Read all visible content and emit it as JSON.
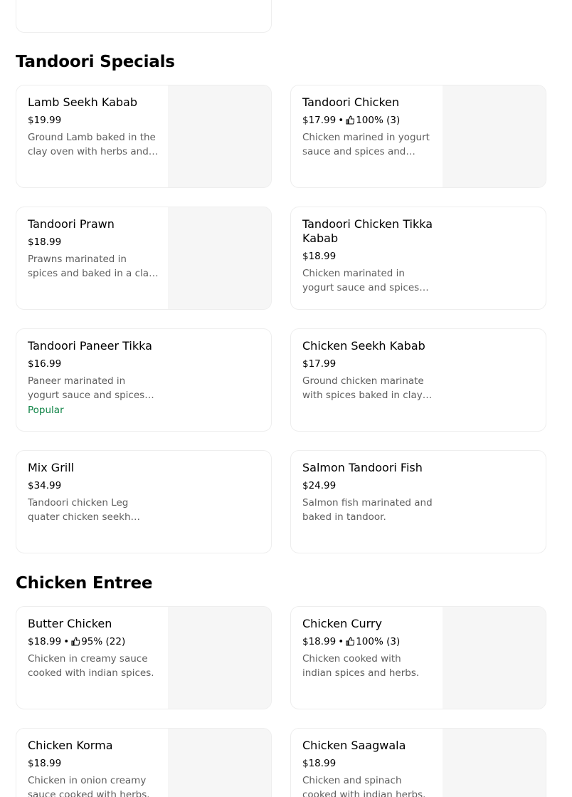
{
  "sections": [
    {
      "title": "Tandoori Specials",
      "items": [
        {
          "name": "Lamb Seekh Kabab",
          "price": "$19.99",
          "rating": "",
          "desc": "Ground Lamb baked in the clay oven with herbs and spices.",
          "badge": "",
          "has_image": true
        },
        {
          "name": "Tandoori Chicken",
          "price": "$17.99",
          "rating": "100% (3)",
          "desc": "Chicken marined in yogurt sauce and spices and baked in a clay oven.",
          "badge": "",
          "has_image": true
        },
        {
          "name": "Tandoori Prawn",
          "price": "$18.99",
          "rating": "",
          "desc": "Prawns marinated in spices and baked in a clay oven.",
          "badge": "",
          "has_image": true
        },
        {
          "name": "Tandoori Chicken Tikka Kabab",
          "price": "$18.99",
          "rating": "",
          "desc": "Chicken marinated in yogurt sauce and spices and baked in a clay oven.",
          "badge": "",
          "has_image": false
        },
        {
          "name": "Tandoori Paneer Tikka",
          "price": "$16.99",
          "rating": "",
          "desc": "Paneer marinated in yogurt sauce and spices and baked in a clay oven.",
          "badge": "Popular",
          "has_image": false
        },
        {
          "name": "Chicken Seekh Kabab",
          "price": "$17.99",
          "rating": "",
          "desc": "Ground chicken marinate with spices baked in clay oven.",
          "badge": "",
          "has_image": false
        },
        {
          "name": "Mix Grill",
          "price": "$34.99",
          "rating": "",
          "desc": "Tandoori chicken Leg quater chicken seekh kabab Lamb seekh kabab.",
          "badge": "",
          "has_image": false
        },
        {
          "name": "Salmon Tandoori Fish",
          "price": "$24.99",
          "rating": "",
          "desc": "Salmon fish marinated and baked in tandoor.",
          "badge": "",
          "has_image": false
        }
      ]
    },
    {
      "title": "Chicken Entree",
      "items": [
        {
          "name": "Butter Chicken",
          "price": "$18.99",
          "rating": "95% (22)",
          "desc": "Chicken in creamy sauce cooked with indian spices.",
          "badge": "",
          "has_image": true
        },
        {
          "name": "Chicken Curry",
          "price": "$18.99",
          "rating": "100% (3)",
          "desc": "Chicken cooked with indian spices and herbs.",
          "badge": "",
          "has_image": true
        },
        {
          "name": "Chicken Korma",
          "price": "$18.99",
          "rating": "",
          "desc": "Chicken in onion creamy sauce cooked with herbs.",
          "badge": "",
          "has_image": true
        },
        {
          "name": "Chicken Saagwala",
          "price": "$18.99",
          "rating": "",
          "desc": "Chicken and spinach cooked with indian herbs.",
          "badge": "",
          "has_image": true
        }
      ]
    }
  ],
  "colors": {
    "popular_badge": "#0e8345",
    "description_text": "#5e5e5e",
    "card_border": "#eeeeee",
    "image_placeholder": "#f6f6f6"
  },
  "icons": {
    "rating": "thumbs-up-icon"
  }
}
